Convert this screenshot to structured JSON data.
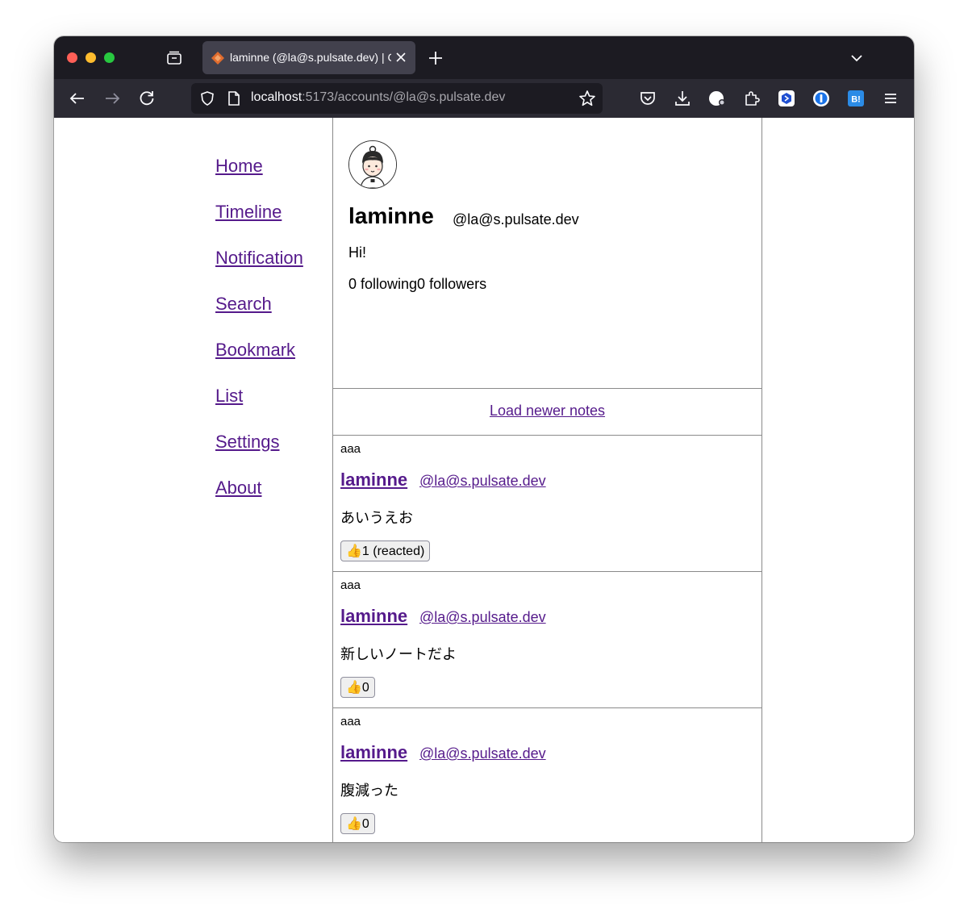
{
  "browser": {
    "tab_title": "laminne (@la@s.pulsate.dev) | C",
    "url_host": "localhost",
    "url_rest": ":5173/accounts/@la@s.pulsate.dev"
  },
  "sidebar": {
    "items": [
      {
        "label": "Home"
      },
      {
        "label": "Timeline"
      },
      {
        "label": "Notification"
      },
      {
        "label": "Search"
      },
      {
        "label": "Bookmark"
      },
      {
        "label": "List"
      },
      {
        "label": "Settings"
      },
      {
        "label": "About"
      }
    ]
  },
  "profile": {
    "name": "laminne",
    "handle": "@la@s.pulsate.dev",
    "bio": "Hi!",
    "stats": "0 following0 followers"
  },
  "timeline": {
    "load_newer": "Load newer notes",
    "notes": [
      {
        "label": "aaa",
        "author": "laminne",
        "handle": "@la@s.pulsate.dev",
        "text": "あいうえお",
        "reaction": "👍1 (reacted)"
      },
      {
        "label": "aaa",
        "author": "laminne",
        "handle": "@la@s.pulsate.dev",
        "text": "新しいノートだよ",
        "reaction": "👍0"
      },
      {
        "label": "aaa",
        "author": "laminne",
        "handle": "@la@s.pulsate.dev",
        "text": "腹減った",
        "reaction": "👍0"
      }
    ]
  },
  "colors": {
    "link": "#551a8b",
    "tabbar": "#1c1b22",
    "navbar": "#2b2a33"
  }
}
